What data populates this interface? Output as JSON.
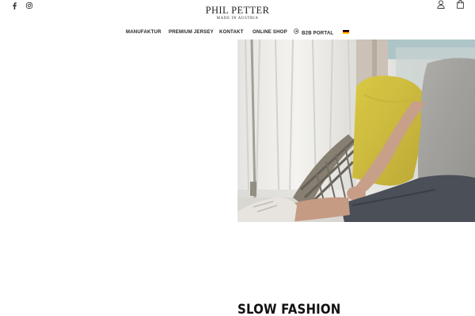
{
  "brand": {
    "logo_text": "PHIL PETTER",
    "tagline": "MADE IN AUSTRIA"
  },
  "social": {
    "facebook_icon": "facebook-icon",
    "instagram_icon": "instagram-icon"
  },
  "header_icons": {
    "account_icon": "user-icon",
    "cart_icon": "shopping-bag-icon"
  },
  "nav": {
    "items": [
      {
        "label": "MANUFAKTUR"
      },
      {
        "label": "PREMIUM JERSEY"
      },
      {
        "label": "KONTAKT"
      },
      {
        "label": "ONLINE SHOP"
      },
      {
        "label": "B2B PORTAL",
        "icon": "login-circle-icon"
      }
    ],
    "language_flag": "german-flag-icon"
  },
  "hero": {
    "image_description_icon": "photo"
  },
  "section": {
    "headline": "SLOW FASHION"
  },
  "colors": {
    "text": "#222222",
    "background": "#ffffff",
    "flag_black": "#000000",
    "flag_red": "#dd0000",
    "flag_gold": "#ffce00"
  }
}
